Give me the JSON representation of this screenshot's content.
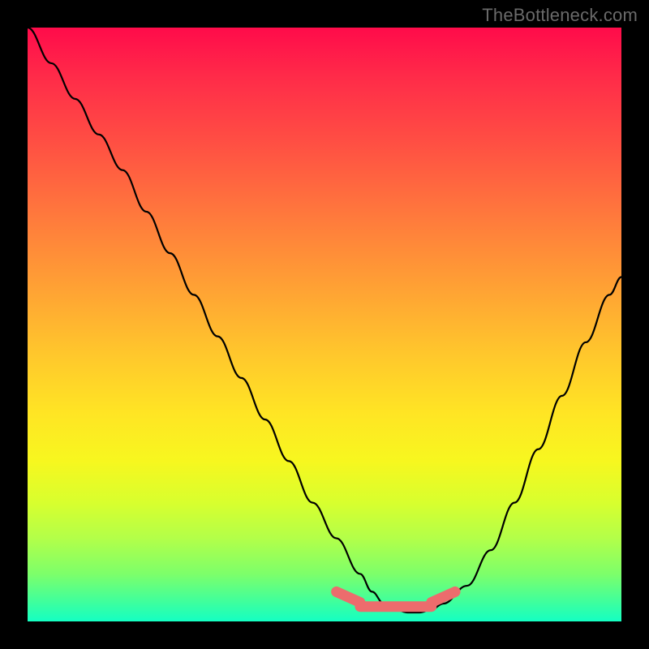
{
  "watermark": "TheBottleneck.com",
  "chart_data": {
    "type": "line",
    "title": "",
    "xlabel": "",
    "ylabel": "",
    "xlim": [
      0,
      100
    ],
    "ylim": [
      0,
      100
    ],
    "series": [
      {
        "name": "curve",
        "x": [
          0,
          4,
          8,
          12,
          16,
          20,
          24,
          28,
          32,
          36,
          40,
          44,
          48,
          52,
          56,
          58,
          60,
          62,
          64,
          66,
          68,
          70,
          74,
          78,
          82,
          86,
          90,
          94,
          98,
          100
        ],
        "values": [
          100,
          94,
          88,
          82,
          76,
          69,
          62,
          55,
          48,
          41,
          34,
          27,
          20,
          14,
          8,
          5,
          3,
          2,
          1.5,
          1.5,
          2,
          3,
          6,
          12,
          20,
          29,
          38,
          47,
          55,
          58
        ]
      }
    ],
    "highlight": {
      "name": "bottom-band",
      "color": "#ec6c6d",
      "segments": [
        {
          "x": [
            52,
            56
          ],
          "y": [
            5.0,
            3.2
          ]
        },
        {
          "x": [
            56,
            68
          ],
          "y": [
            2.5,
            2.5
          ]
        },
        {
          "x": [
            68,
            72
          ],
          "y": [
            3.2,
            5.0
          ]
        }
      ]
    }
  }
}
